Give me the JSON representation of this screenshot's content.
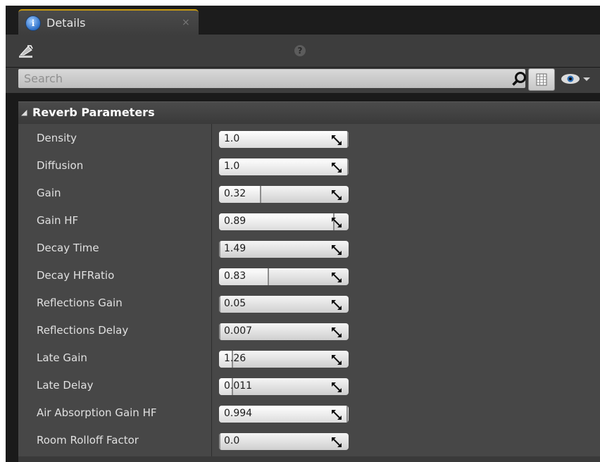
{
  "tab": {
    "title": "Details",
    "close": "×"
  },
  "search": {
    "placeholder": "Search"
  },
  "section": {
    "title": "Reverb Parameters"
  },
  "properties": [
    {
      "label": "Density",
      "value": "1.0",
      "fill": 1.0
    },
    {
      "label": "Diffusion",
      "value": "1.0",
      "fill": 1.0
    },
    {
      "label": "Gain",
      "value": "0.32",
      "fill": 0.32
    },
    {
      "label": "Gain HF",
      "value": "0.89",
      "fill": 0.89
    },
    {
      "label": "Decay Time",
      "value": "1.49",
      "fill": 0.0
    },
    {
      "label": "Decay HFRatio",
      "value": "0.83",
      "fill": 0.38
    },
    {
      "label": "Reflections Gain",
      "value": "0.05",
      "fill": 0.0
    },
    {
      "label": "Reflections Delay",
      "value": "0.007",
      "fill": 0.0
    },
    {
      "label": "Late Gain",
      "value": "1.26",
      "fill": 0.1
    },
    {
      "label": "Late Delay",
      "value": "0.011",
      "fill": 0.1
    },
    {
      "label": "Air Absorption Gain HF",
      "value": "0.994",
      "fill": 0.994
    },
    {
      "label": "Room Rolloff Factor",
      "value": "0.0",
      "fill": 0.0
    }
  ],
  "colors": {
    "accent": "#c89a10",
    "panel": "#474747",
    "header": "#3d3d3d"
  }
}
